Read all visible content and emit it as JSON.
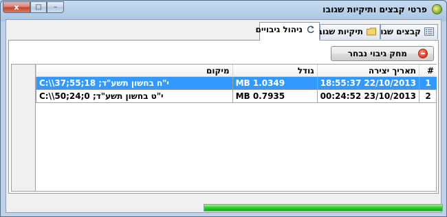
{
  "window": {
    "title": "פרטי קבצים ותיקיות שגובו",
    "close": "x",
    "maximize": "□",
    "minimize": "–"
  },
  "tabs": [
    {
      "label": "קבצים שגובו",
      "icon": "list-icon"
    },
    {
      "label": "תיקיות שגובו",
      "icon": "folder-icon"
    },
    {
      "label": "ניהול גיבויים",
      "icon": "refresh-icon",
      "active": true
    }
  ],
  "toolbar": {
    "delete_label": "מחק גיבוי נבחר",
    "delete_icon": "minus-circle-icon"
  },
  "table": {
    "headers": {
      "num": "#",
      "date": "תאריך יצירה",
      "size": "גודל",
      "location": "מיקום"
    },
    "rows": [
      {
        "num": "1",
        "date": "18:55:37 22/10/2013",
        "size": "MB 1.0349",
        "location": "C:\\\\י\"ח בחשון תשע\"ד; 18;55;37"
      },
      {
        "num": "2",
        "date": "00:24:52 23/10/2013",
        "size": "MB 0.7935",
        "location": "C:\\\\י\"ט בחשון תשע\"ד; 0;24;50"
      }
    ],
    "selected_row": 1
  },
  "status": {
    "progress": 1.0
  },
  "colors": {
    "selection": "#3399ff",
    "progress": "#2fcc2f"
  }
}
